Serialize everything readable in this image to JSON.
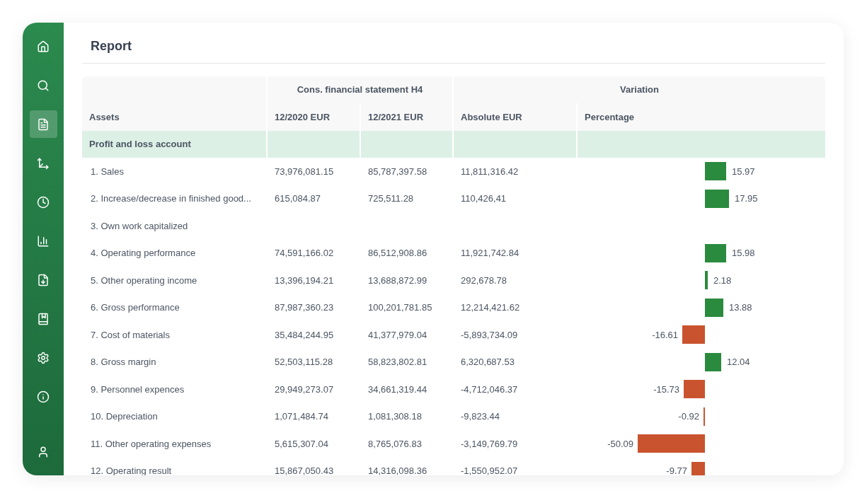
{
  "sidebar": {
    "items": [
      {
        "kind": "home",
        "selected": false
      },
      {
        "kind": "search",
        "selected": false
      },
      {
        "kind": "report",
        "selected": true
      },
      {
        "kind": "axes",
        "selected": false
      },
      {
        "kind": "clock",
        "selected": false
      },
      {
        "kind": "chart",
        "selected": false
      },
      {
        "kind": "download",
        "selected": false
      },
      {
        "kind": "book",
        "selected": false
      },
      {
        "kind": "settings",
        "selected": false
      },
      {
        "kind": "info",
        "selected": false
      }
    ],
    "footer_items": [
      {
        "kind": "user",
        "selected": false
      }
    ]
  },
  "title": "Report",
  "table": {
    "group_headers": [
      "Cons. financial statement H4",
      "Variation"
    ],
    "columns": [
      "Assets",
      "12/2020 EUR",
      "12/2021 EUR",
      "Absolute EUR",
      "Percentage"
    ],
    "section": "Profit and loss account",
    "rows": [
      {
        "label": "1. Sales",
        "y2020": "73,976,081.15",
        "y2021": "85,787,397.58",
        "absolute": "11,811,316.42",
        "percentage": "15.97",
        "kind": "positive"
      },
      {
        "label": "2. Increase/decrease in finished good...",
        "y2020": "615,084.87",
        "y2021": "725,511.28",
        "absolute": "110,426,41",
        "percentage": "17.95",
        "kind": "positive"
      },
      {
        "label": "3. Own work capitalized",
        "kind": "empty"
      },
      {
        "label": "4. Operating performance",
        "y2020": "74,591,166.02",
        "y2021": "86,512,908.86",
        "absolute": "11,921,742.84",
        "percentage": "15.98",
        "kind": "positive"
      },
      {
        "label": "5. Other operating income",
        "y2020": "13,396,194.21",
        "y2021": "13,688,872.99",
        "absolute": "292,678.78",
        "percentage": "2.18",
        "kind": "positive"
      },
      {
        "label": "6. Gross performance",
        "y2020": "87,987,360.23",
        "y2021": "100,201,781.85",
        "absolute": "12,214,421.62",
        "percentage": "13.88",
        "kind": "positive"
      },
      {
        "label": "7. Cost of materials",
        "y2020": "35,484,244.95",
        "y2021": "41,377,979.04",
        "absolute": "-5,893,734.09",
        "percentage": "-16.61",
        "kind": "negative"
      },
      {
        "label": "8. Gross margin",
        "y2020": "52,503,115.28",
        "y2021": "58,823,802.81",
        "absolute": "6,320,687.53",
        "percentage": "12.04",
        "kind": "positive"
      },
      {
        "label": "9. Personnel expences",
        "y2020": "29,949,273.07",
        "y2021": "34,661,319.44",
        "absolute": "-4,712,046.37",
        "percentage": "-15.73",
        "kind": "negative"
      },
      {
        "label": "10. Depreciation",
        "y2020": "1,071,484.74",
        "y2021": "1,081,308.18",
        "absolute": "-9,823.44",
        "percentage": "-0.92",
        "kind": "negative"
      },
      {
        "label": "11. Other operating expenses",
        "y2020": "5,615,307.04",
        "y2021": "8,765,076.83",
        "absolute": "-3,149,769.79",
        "percentage": "-50.09",
        "kind": "negative"
      },
      {
        "label": "12. Operating result",
        "y2020": "15,867,050.43",
        "y2021": "14,316,098.36",
        "absolute": "-1,550,952.07",
        "percentage": "-9.77",
        "kind": "negative"
      }
    ]
  }
}
